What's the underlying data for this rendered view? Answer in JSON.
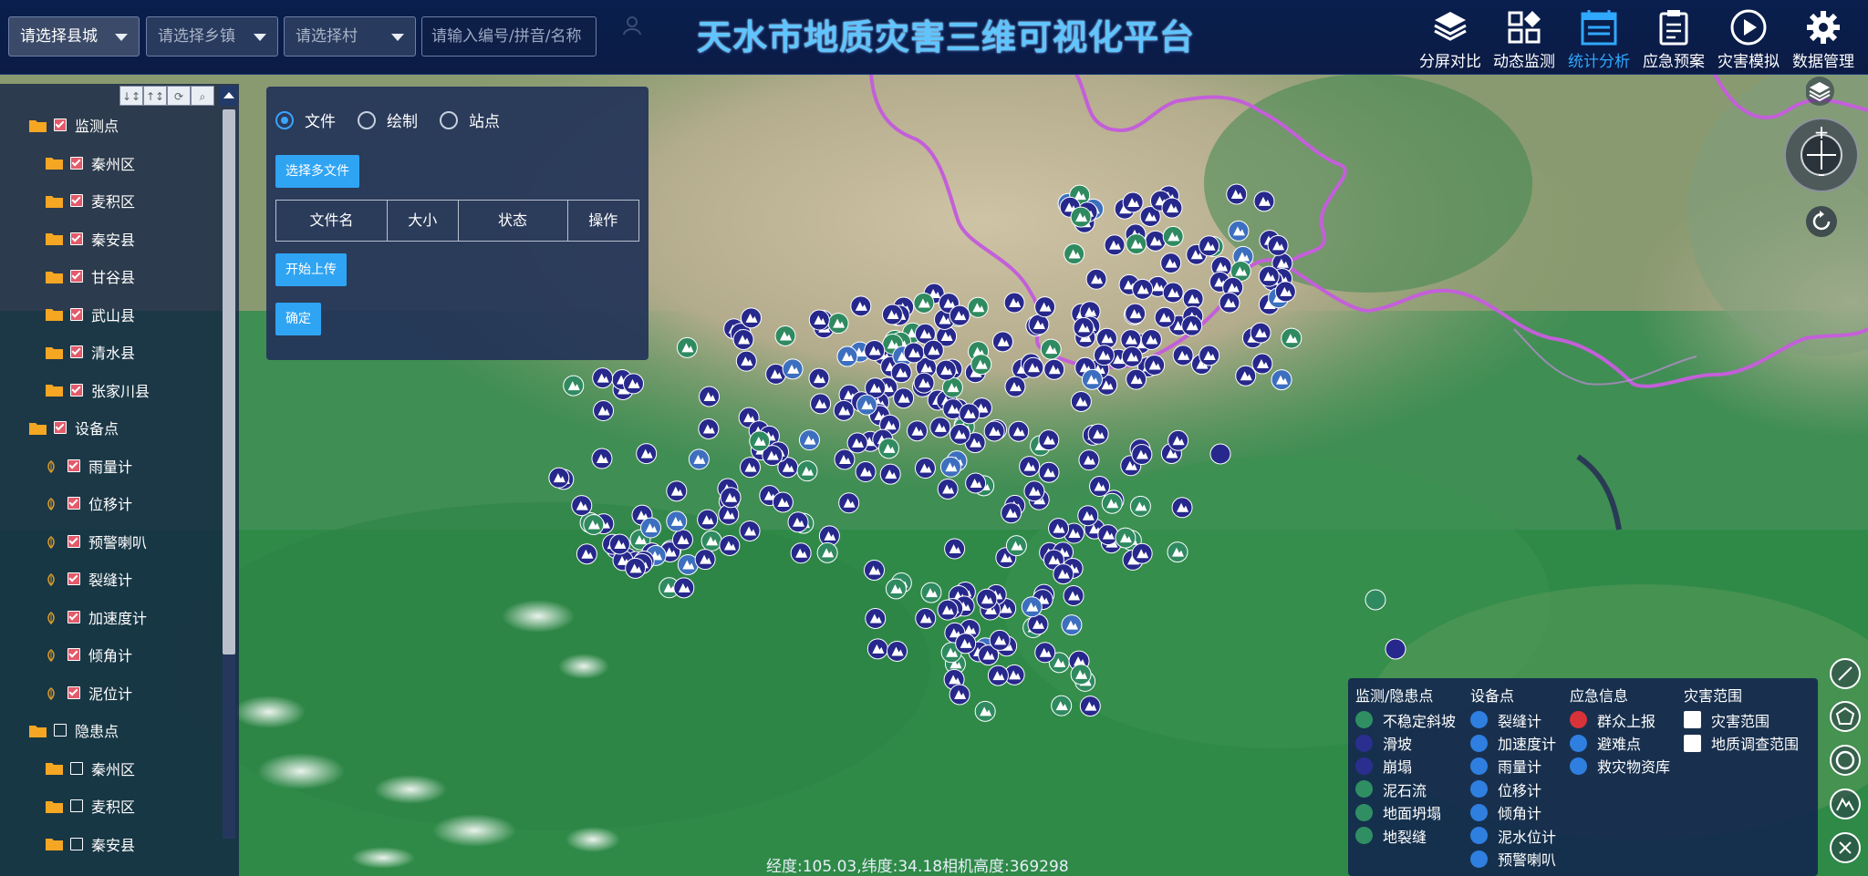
{
  "header": {
    "title": "天水市地质灾害三维可视化平台",
    "county_select": "请选择县城",
    "town_select": "请选择乡镇",
    "village_select": "请选择村",
    "search_placeholder": "请输入编号/拼音/名称",
    "nav": [
      {
        "label": "分屏对比",
        "icon": "layers-icon"
      },
      {
        "label": "动态监测",
        "icon": "grid-shapes-icon"
      },
      {
        "label": "统计分析",
        "icon": "calendar-chart-icon",
        "active": true
      },
      {
        "label": "应急预案",
        "icon": "clipboard-icon"
      },
      {
        "label": "灾害模拟",
        "icon": "play-circle-icon"
      },
      {
        "label": "数据管理",
        "icon": "gear-icon"
      }
    ],
    "accent_color": "#2fa8ff"
  },
  "tree": {
    "groups": [
      {
        "label": "监测点",
        "checked": true,
        "children": [
          "秦州区",
          "麦积区",
          "秦安县",
          "甘谷县",
          "武山县",
          "清水县",
          "张家川县"
        ]
      },
      {
        "label": "设备点",
        "checked": true,
        "children": [
          "雨量计",
          "位移计",
          "预警喇叭",
          "裂缝计",
          "加速度计",
          "倾角计",
          "泥位计"
        ]
      },
      {
        "label": "隐患点",
        "checked": false,
        "children": [
          "秦州区",
          "麦积区",
          "秦安县"
        ]
      }
    ]
  },
  "upload": {
    "modes": [
      "文件",
      "绘制",
      "站点"
    ],
    "selected_mode": "文件",
    "select_files_label": "选择多文件",
    "columns": [
      "文件名",
      "大小",
      "状态",
      "操作"
    ],
    "start_upload_label": "开始上传",
    "confirm_label": "确定"
  },
  "legend": {
    "col1_title": "监测/隐患点",
    "col1_items": [
      "不稳定斜坡",
      "滑坡",
      "崩塌",
      "泥石流",
      "地面坍塌",
      "地裂缝"
    ],
    "col2_title": "设备点",
    "col2_items": [
      "裂缝计",
      "加速度计",
      "雨量计",
      "位移计",
      "倾角计",
      "泥水位计",
      "预警喇叭"
    ],
    "col3_title": "应急信息",
    "col3_items": [
      "群众上报",
      "避难点",
      "救灾物资库"
    ],
    "col4_title": "灾害范围",
    "col4_items": [
      "灾害范围",
      "地质调查范围"
    ]
  },
  "status": {
    "coord_text": "经度:105.03,纬度:34.18相机高度:369298"
  }
}
